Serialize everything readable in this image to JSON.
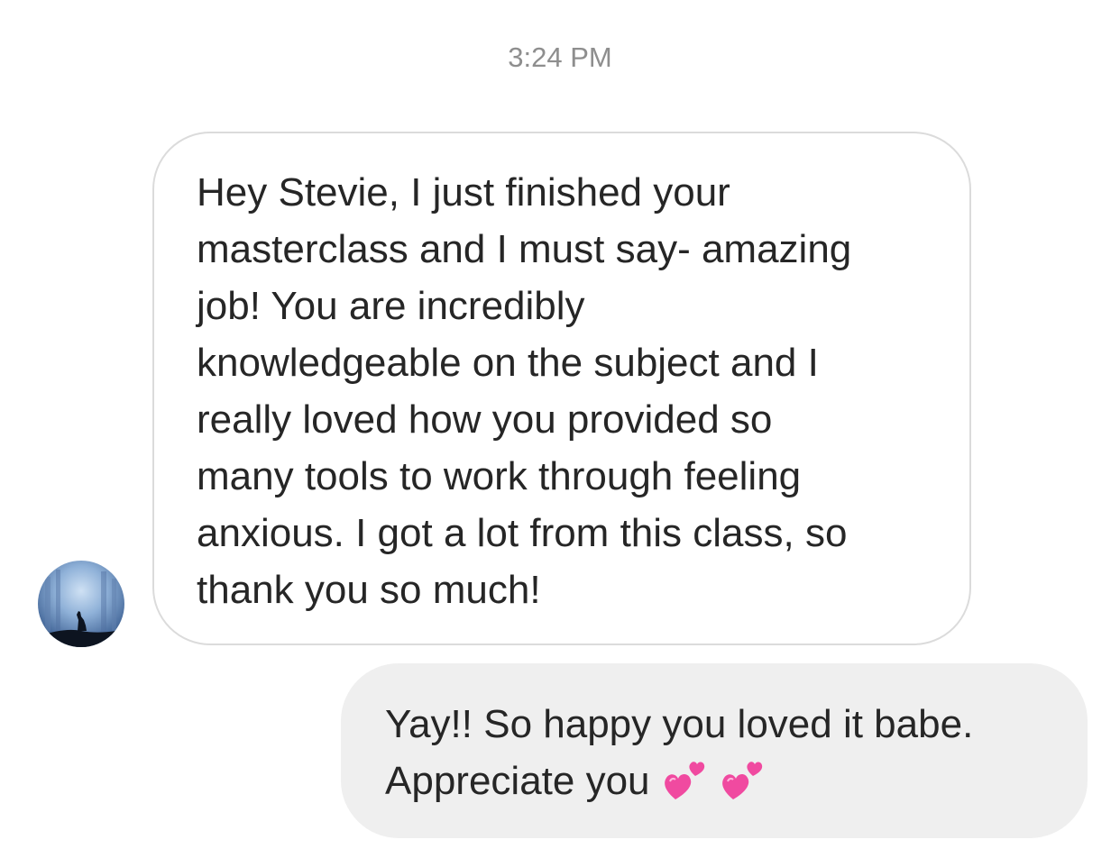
{
  "conversation": {
    "timestamp": "3:24 PM",
    "incoming": {
      "avatar_icon": "wolf-silhouette-avatar",
      "text": "Hey Stevie, I just finished your\nmasterclass and I must say- amazing\njob! You are incredibly\nknowledgeable on the subject and I\nreally loved how you provided so\nmany tools to work through feeling\nanxious. I got a lot from this class, so\nthank you so much!"
    },
    "outgoing": {
      "line1": "Yay!! So happy you loved it babe.",
      "line2": "Appreciate you",
      "emoji_icons": [
        "two-hearts-icon",
        "two-hearts-icon"
      ]
    }
  },
  "colors": {
    "timestamp": "#8e8e8e",
    "text": "#262626",
    "incoming_border": "#dbdbdb",
    "outgoing_bg": "#efefef",
    "heart": "#f04aa0"
  }
}
